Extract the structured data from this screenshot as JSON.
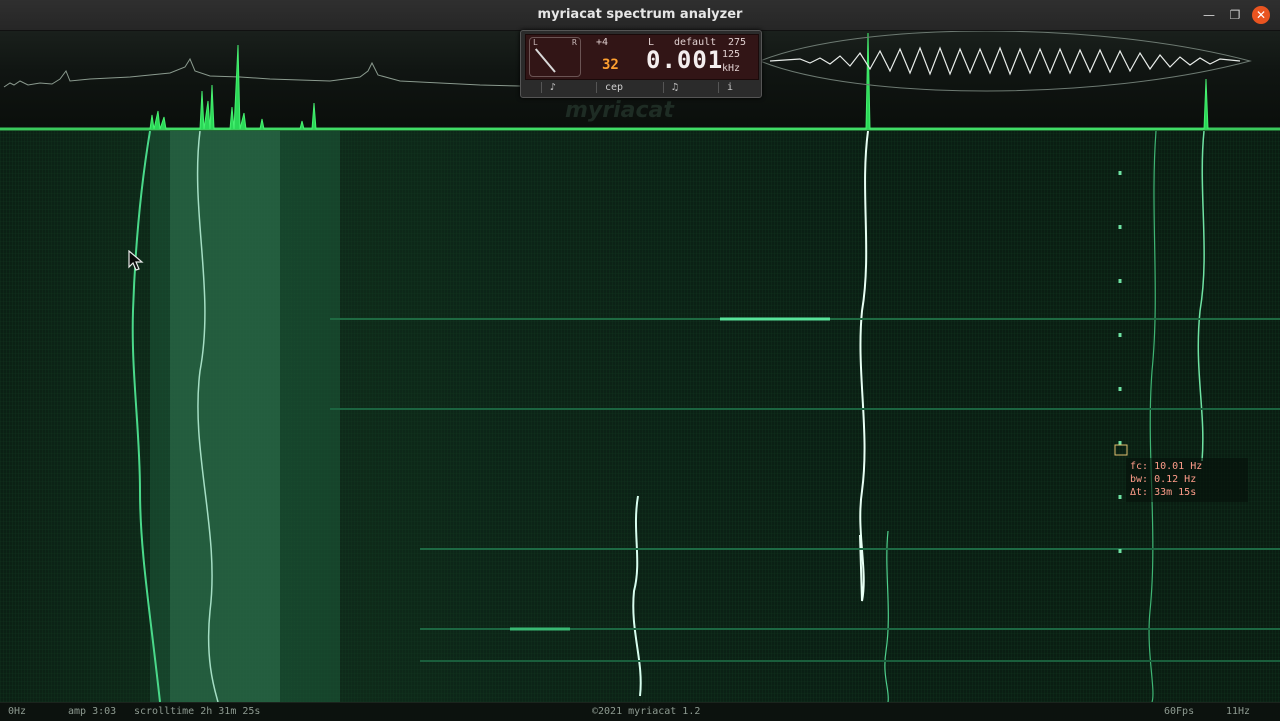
{
  "window": {
    "title": "myriacat spectrum analyzer",
    "min_glyph": "—",
    "max_glyph": "❐",
    "close_glyph": "✕"
  },
  "panel": {
    "meter_left": "L",
    "meter_right": "R",
    "gain": "+4",
    "channel": "L",
    "preset": "default",
    "preset_value": "275",
    "orange_value": "32",
    "frequency_value": "0.001",
    "sample_rate": "125",
    "unit": "kHz",
    "controls": [
      "♪",
      "cep",
      "♫",
      "i"
    ]
  },
  "watermark": "myriacat",
  "tooltip": {
    "fc": "fc: 10.01 Hz",
    "bw": "bw: 0.12 Hz",
    "dt": "Δt: 33m 15s"
  },
  "status": {
    "low_freq": "0Hz",
    "amp": "amp 3:03",
    "scrolltime": "scrolltime 2h 31m 25s",
    "copyright": "©2021 myriacat 1.2",
    "fps": "60Fps",
    "high_freq": "11Hz"
  },
  "colors": {
    "accent": "#2bd95a",
    "marker": "#d6a52a",
    "trace": "#a8ffd8",
    "tooltip_text": "#ff9d8a"
  }
}
